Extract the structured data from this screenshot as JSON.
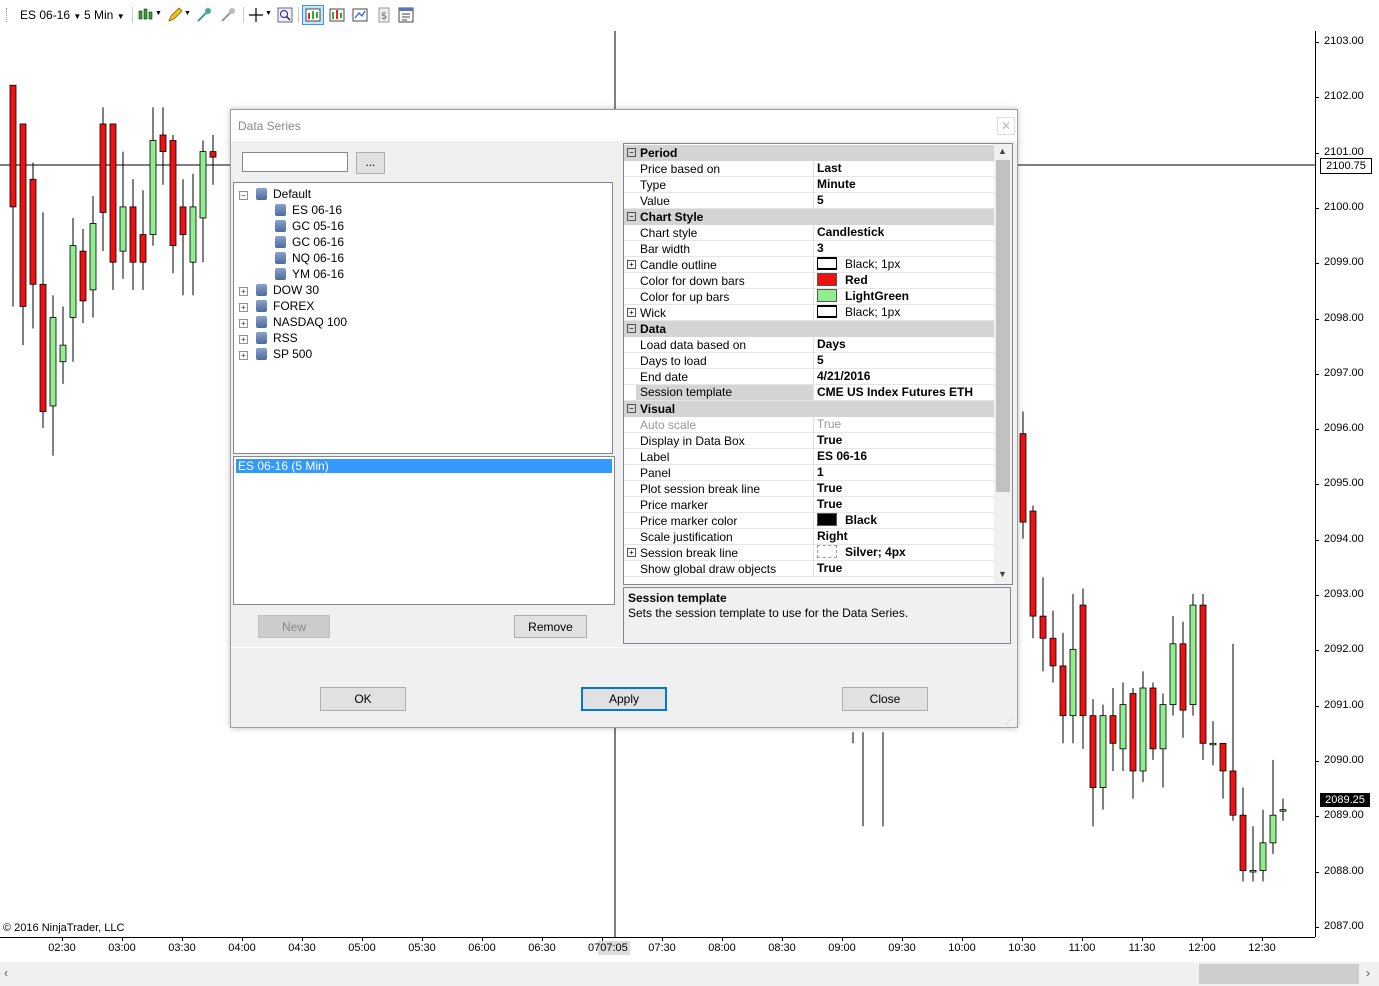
{
  "toolbar": {
    "instrument": "ES 06-16",
    "interval": "5 Min"
  },
  "chart": {
    "price_ticks": [
      "2103.00",
      "2102.00",
      "2101.00",
      "2100.00",
      "2099.00",
      "2098.00",
      "2097.00",
      "2096.00",
      "2095.00",
      "2094.00",
      "2093.00",
      "2092.00",
      "2091.00",
      "2090.00",
      "2089.00",
      "2088.00",
      "2087.00"
    ],
    "price_markers": {
      "upper": "2100.75",
      "lower": "2089.25"
    },
    "time_ticks": [
      "02:30",
      "03:00",
      "03:30",
      "04:00",
      "04:30",
      "05:00",
      "05:30",
      "06:00",
      "06:30",
      "07:00",
      "07:30",
      "08:00",
      "08:30",
      "09:00",
      "09:30",
      "10:00",
      "10:30",
      "11:00",
      "11:30",
      "12:00",
      "12:30"
    ],
    "crosshair_time": "07:05",
    "copyright": "© 2016 NinjaTrader, LLC",
    "colors": {
      "up": "#90ee90",
      "down": "#ee1111"
    }
  },
  "dialog": {
    "title": "Data Series",
    "search_button": "...",
    "tree": [
      {
        "label": "Default",
        "children": [
          "ES 06-16",
          "GC 05-16",
          "GC 06-16",
          "NQ 06-16",
          "YM 06-16"
        ]
      },
      {
        "label": "DOW 30"
      },
      {
        "label": "FOREX"
      },
      {
        "label": "NASDAQ 100"
      },
      {
        "label": "RSS"
      },
      {
        "label": "SP 500"
      }
    ],
    "selected_series": "ES 06-16 (5 Min)",
    "new_button": "New",
    "remove_button": "Remove",
    "ok_button": "OK",
    "apply_button": "Apply",
    "close_button": "Close",
    "properties": [
      {
        "cat": "Period"
      },
      {
        "name": "Price based on",
        "value": "Last"
      },
      {
        "name": "Type",
        "value": "Minute"
      },
      {
        "name": "Value",
        "value": "5"
      },
      {
        "cat": "Chart Style"
      },
      {
        "name": "Chart style",
        "value": "Candlestick"
      },
      {
        "name": "Bar width",
        "value": "3"
      },
      {
        "name": "Candle outline",
        "value": "Black; 1px",
        "swatch": "outline",
        "expand": true
      },
      {
        "name": "Color for down bars",
        "value": "Red",
        "swatch": "#ee1111"
      },
      {
        "name": "Color for up bars",
        "value": "LightGreen",
        "swatch": "#90ee90"
      },
      {
        "name": "Wick",
        "value": "Black; 1px",
        "swatch": "outline",
        "expand": true
      },
      {
        "cat": "Data"
      },
      {
        "name": "Load data based on",
        "value": "Days"
      },
      {
        "name": "Days to load",
        "value": "5"
      },
      {
        "name": "End date",
        "value": "4/21/2016"
      },
      {
        "name": "Session template",
        "value": "CME US Index Futures ETH",
        "selected": true
      },
      {
        "cat": "Visual"
      },
      {
        "name": "Auto scale",
        "value": "True",
        "disabled": true
      },
      {
        "name": "Display in Data Box",
        "value": "True"
      },
      {
        "name": "Label",
        "value": "ES 06-16"
      },
      {
        "name": "Panel",
        "value": "1"
      },
      {
        "name": "Plot session break line",
        "value": "True"
      },
      {
        "name": "Price marker",
        "value": "True"
      },
      {
        "name": "Price marker color",
        "value": "Black",
        "swatch": "#000000"
      },
      {
        "name": "Scale justification",
        "value": "Right"
      },
      {
        "name": "Session break line",
        "value": "Silver; 4px",
        "swatch": "dashed",
        "expand": true
      },
      {
        "name": "Show global draw objects",
        "value": "True"
      }
    ],
    "description": {
      "title": "Session template",
      "text": "Sets the session template to use for the Data Series."
    }
  }
}
